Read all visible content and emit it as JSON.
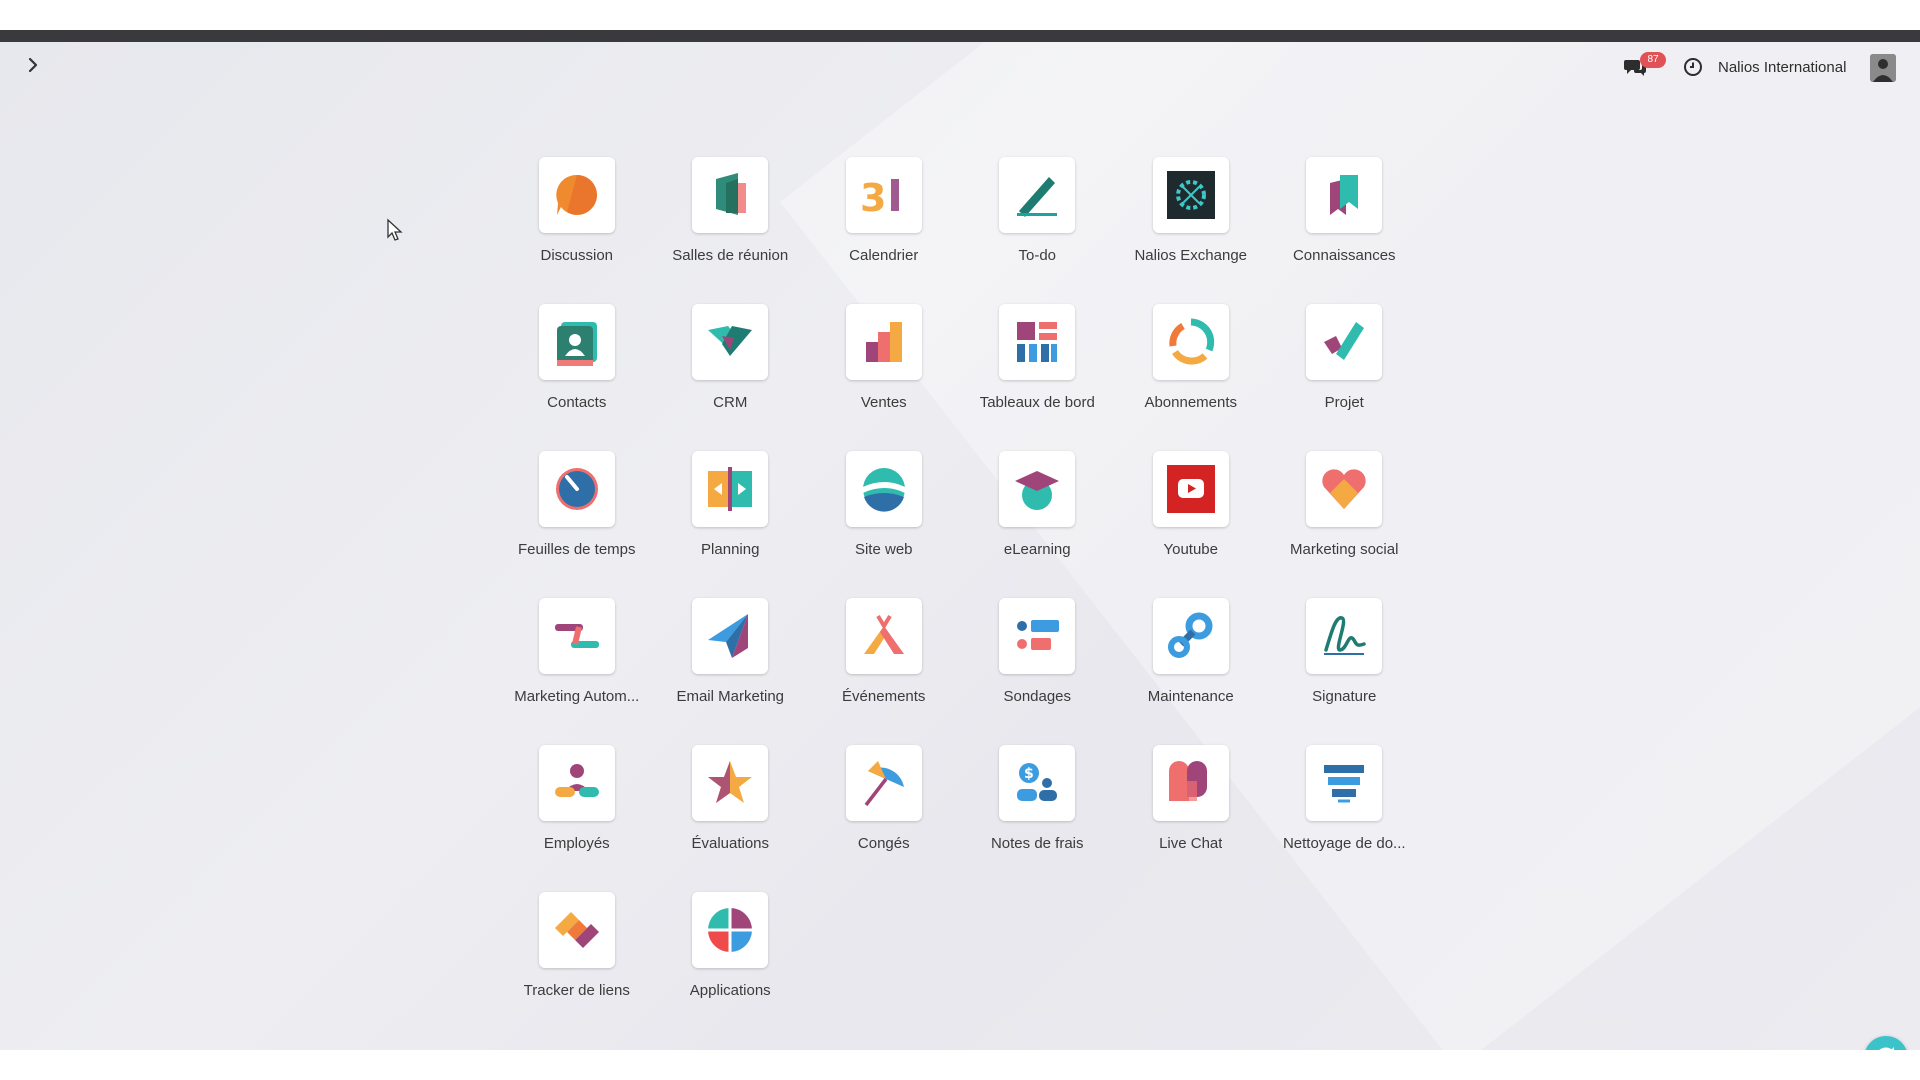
{
  "navbar": {
    "toggle_icon": "chevron-right-icon",
    "chat_icon": "chat-bubbles-icon",
    "chat_badge": "87",
    "activity_icon": "clock-icon",
    "company": "Nalios International",
    "avatar_icon": "user-avatar"
  },
  "apps": [
    {
      "label": "Discussion",
      "icon": "discussion-icon"
    },
    {
      "label": "Salles de réunion",
      "icon": "meeting-room-icon"
    },
    {
      "label": "Calendrier",
      "icon": "calendar-icon"
    },
    {
      "label": "To-do",
      "icon": "todo-icon"
    },
    {
      "label": "Nalios Exchange",
      "icon": "exchange-icon"
    },
    {
      "label": "Connaissances",
      "icon": "knowledge-icon"
    },
    {
      "label": "Contacts",
      "icon": "contacts-icon"
    },
    {
      "label": "CRM",
      "icon": "crm-icon"
    },
    {
      "label": "Ventes",
      "icon": "sales-icon"
    },
    {
      "label": "Tableaux de bord",
      "icon": "dashboards-icon"
    },
    {
      "label": "Abonnements",
      "icon": "subscriptions-icon"
    },
    {
      "label": "Projet",
      "icon": "project-icon"
    },
    {
      "label": "Feuilles de temps",
      "icon": "timesheets-icon"
    },
    {
      "label": "Planning",
      "icon": "planning-icon"
    },
    {
      "label": "Site web",
      "icon": "website-icon"
    },
    {
      "label": "eLearning",
      "icon": "elearning-icon"
    },
    {
      "label": "Youtube",
      "icon": "youtube-icon"
    },
    {
      "label": "Marketing social",
      "icon": "social-marketing-icon"
    },
    {
      "label": "Marketing Autom...",
      "icon": "marketing-automation-icon"
    },
    {
      "label": "Email Marketing",
      "icon": "email-marketing-icon"
    },
    {
      "label": "Événements",
      "icon": "events-icon"
    },
    {
      "label": "Sondages",
      "icon": "surveys-icon"
    },
    {
      "label": "Maintenance",
      "icon": "maintenance-icon"
    },
    {
      "label": "Signature",
      "icon": "signature-icon"
    },
    {
      "label": "Employés",
      "icon": "employees-icon"
    },
    {
      "label": "Évaluations",
      "icon": "appraisals-icon"
    },
    {
      "label": "Congés",
      "icon": "time-off-icon"
    },
    {
      "label": "Notes de frais",
      "icon": "expenses-icon"
    },
    {
      "label": "Live Chat",
      "icon": "live-chat-icon"
    },
    {
      "label": "Nettoyage de do...",
      "icon": "data-cleaning-icon"
    },
    {
      "label": "Tracker de liens",
      "icon": "link-tracker-icon"
    },
    {
      "label": "Applications",
      "icon": "apps-icon"
    }
  ],
  "fab_icon": "refresh-icon"
}
